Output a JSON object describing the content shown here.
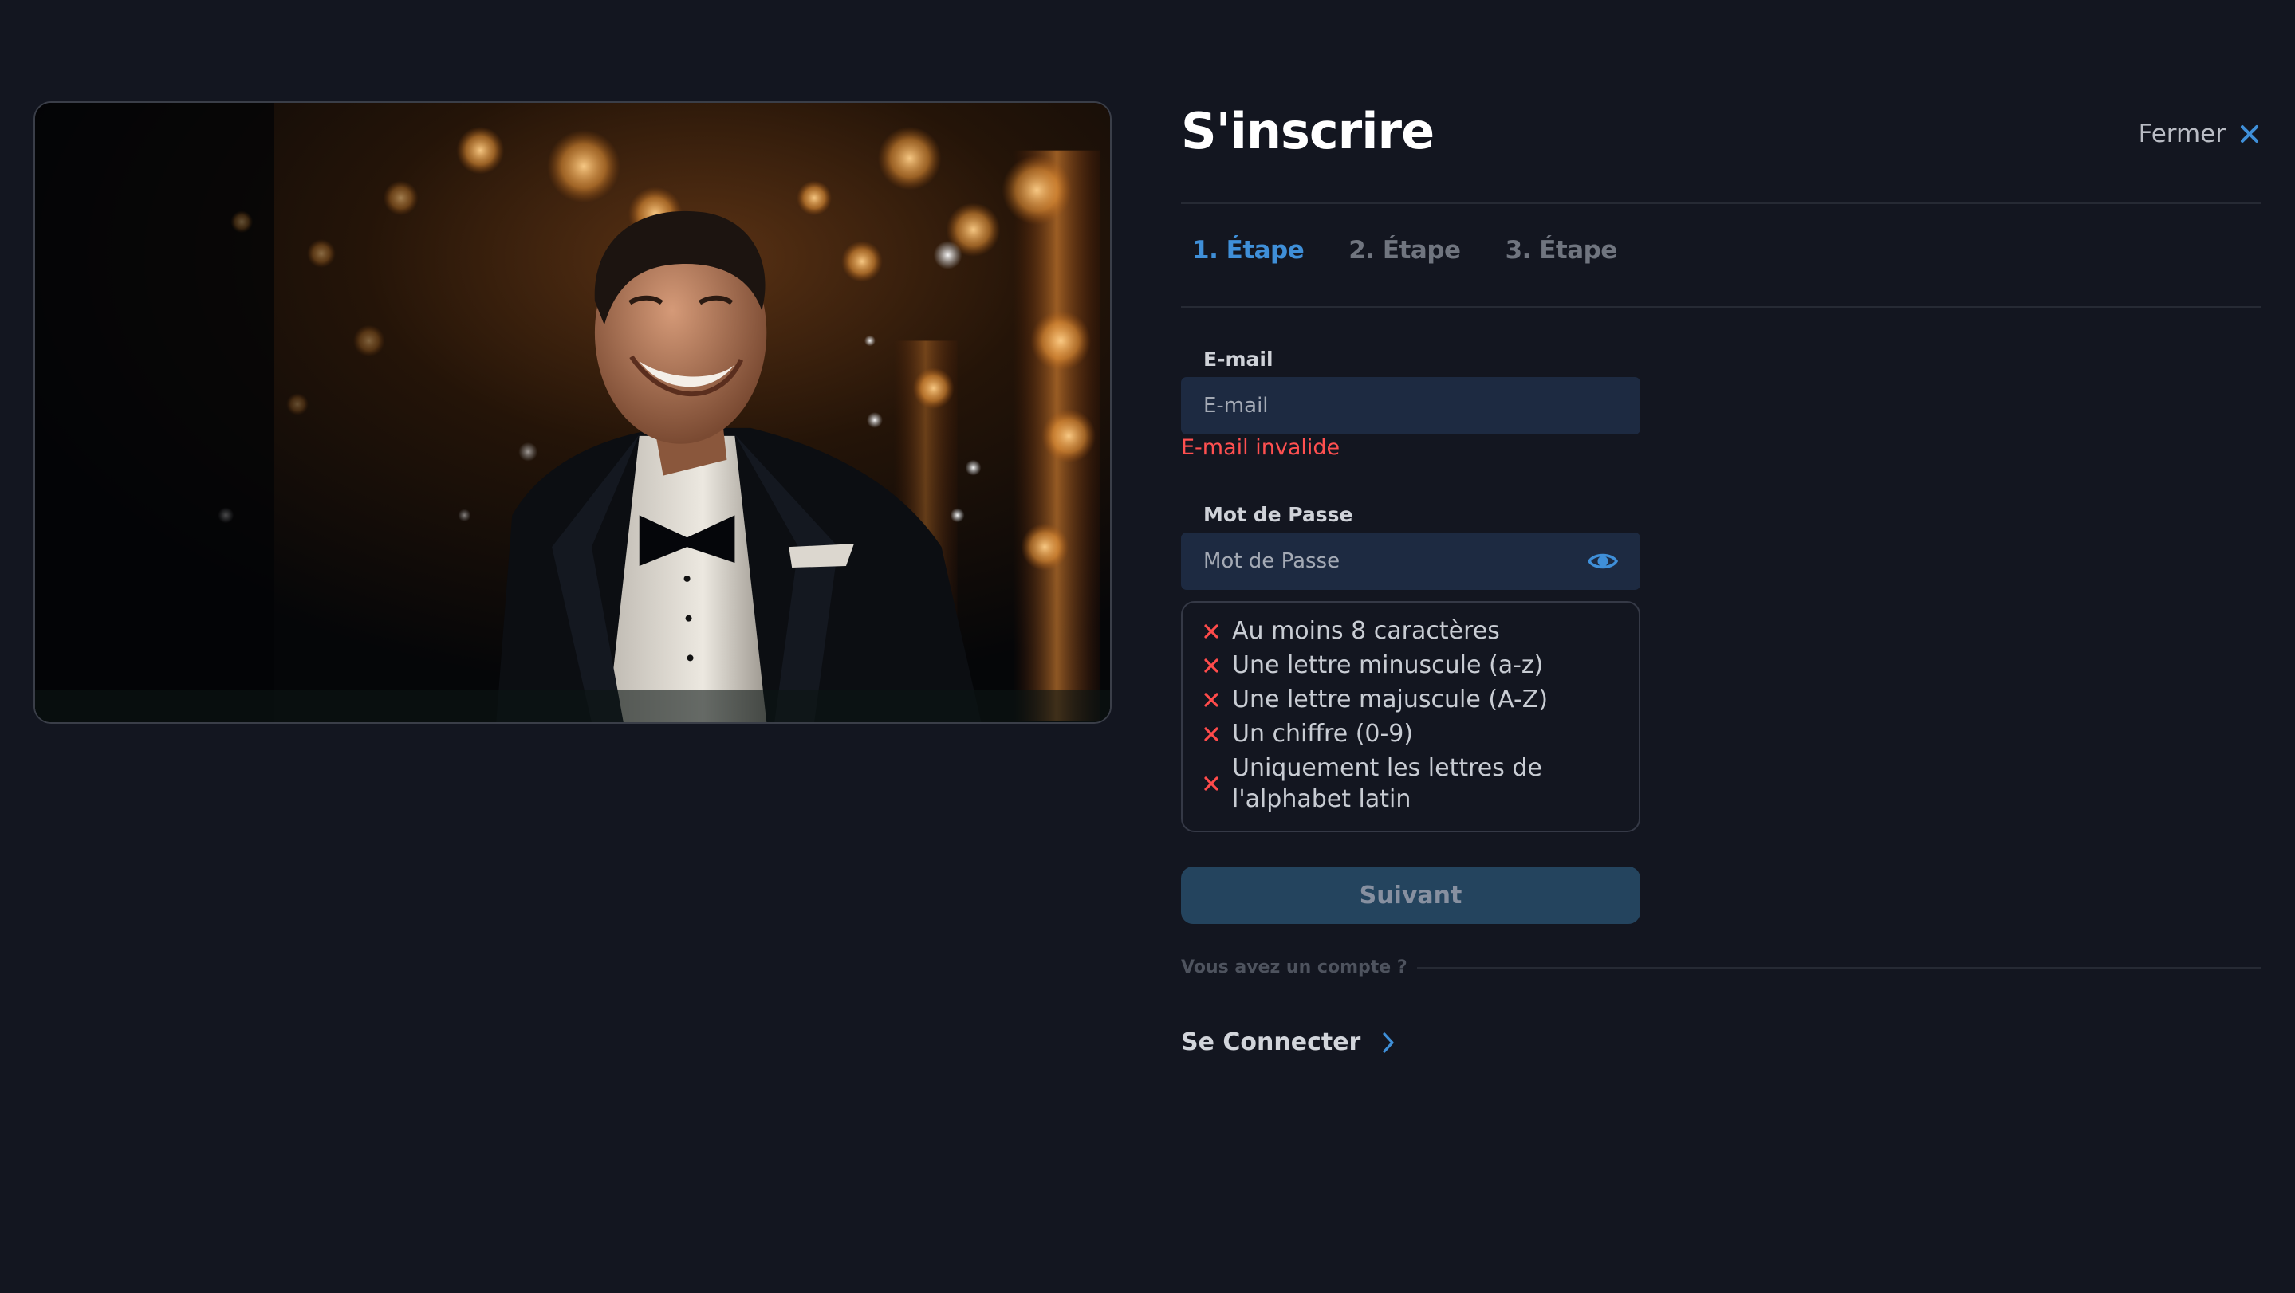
{
  "header": {
    "title": "S'inscrire",
    "close_label": "Fermer"
  },
  "steps": [
    {
      "label": "1. Étape",
      "active": true
    },
    {
      "label": "2. Étape",
      "active": false
    },
    {
      "label": "3. Étape",
      "active": false
    }
  ],
  "email": {
    "label": "E-mail",
    "placeholder": "E-mail",
    "value": "",
    "error": "E-mail invalide"
  },
  "password": {
    "label": "Mot de Passe",
    "placeholder": "Mot de Passe",
    "value": ""
  },
  "password_rules": [
    {
      "line1": "Au moins 8 caractères",
      "line2": "",
      "met": false
    },
    {
      "line1": "Une lettre minuscule (a-z)",
      "line2": "",
      "met": false
    },
    {
      "line1": "Une lettre majuscule (A-Z)",
      "line2": "",
      "met": false
    },
    {
      "line1": "Un chiffre (0-9)",
      "line2": "",
      "met": false
    },
    {
      "line1": "Uniquement les lettres de",
      "line2": "l'alphabet latin",
      "met": false
    }
  ],
  "next_button": "Suivant",
  "account": {
    "question": "Vous avez un compte ?",
    "login_label": "Se Connecter"
  },
  "colors": {
    "background": "#131620",
    "accent": "#3f8fd8",
    "error": "#ff5050",
    "input_bg": "#1d2a41",
    "button_bg": "#24445e"
  },
  "icons": {
    "close": "close-icon",
    "eye": "eye-icon",
    "rule_fail": "cross-icon",
    "chevron": "chevron-right-icon"
  }
}
